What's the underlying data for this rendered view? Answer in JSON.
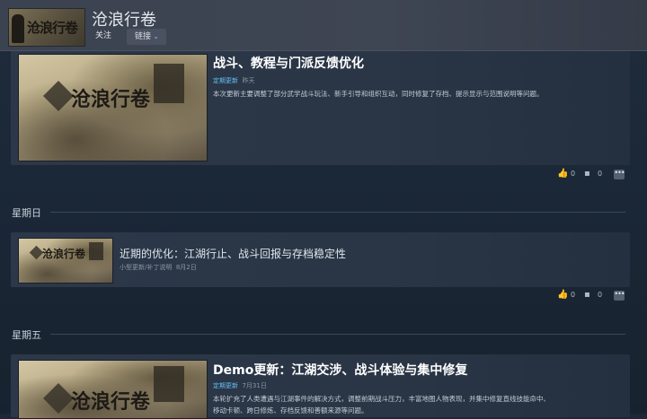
{
  "header": {
    "logo_text": "沧浪行卷",
    "app_title": "沧浪行卷",
    "follow_label": "关注",
    "links_label": "链接"
  },
  "posts": [
    {
      "title": "战斗、教程与门派反馈优化",
      "tag": "定期更新",
      "date": "昨天",
      "description": "本次更新主要调整了部分武学战斗玩法、新手引导和组织互动，同时修复了存档、提示显示与范围说明等问题。",
      "likes": "0",
      "comments": "0"
    },
    {
      "day_label": "星期日",
      "title": "近期的优化：江湖行止、战斗回报与存档稳定性",
      "tag": "小型更新/补丁说明",
      "date": "8月2日",
      "likes": "0",
      "comments": "0"
    },
    {
      "day_label": "星期五",
      "title": "Demo更新：江湖交涉、战斗体验与集中修复",
      "tag": "定期更新",
      "date": "7月31日",
      "description_line1": "本轮扩充了人类遭遇与江湖事件的解决方式，调整前期战斗压力，丰富地图人物表现，并集中修复直线技能命中、",
      "description_line2": "移动卡顿、跨日修炼、存档反馈和善额来源等问题。"
    }
  ],
  "icons": {
    "like": "thumbs-up-icon",
    "comment": "comment-icon",
    "more": "more-icon",
    "chevron": "chevron-down-icon"
  },
  "colors": {
    "background": "#1b2838",
    "accent": "#66c0f4",
    "card": "#2c3849"
  }
}
